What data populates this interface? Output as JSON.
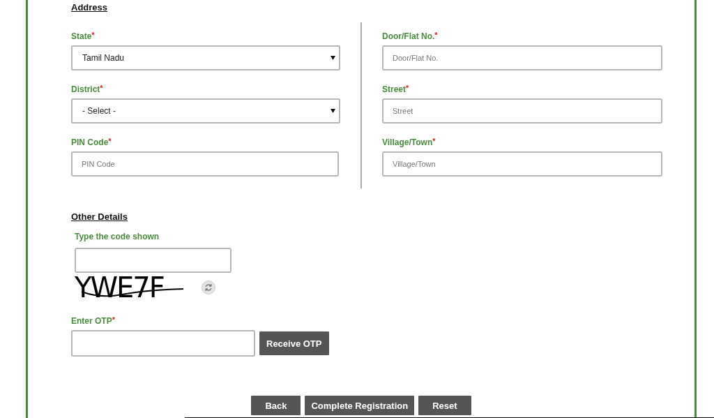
{
  "address": {
    "heading": "Address",
    "left": [
      {
        "kind": "select",
        "label": "State",
        "required_mark": "*",
        "value": "Tamil Nadu"
      },
      {
        "kind": "select",
        "label": "District",
        "required_mark": "*",
        "value": "- Select -"
      },
      {
        "kind": "text",
        "label": "PIN Code",
        "required_mark": "*",
        "placeholder": "PIN Code"
      }
    ],
    "right": [
      {
        "kind": "text",
        "label": "Door/Flat No.",
        "required_mark": "*",
        "placeholder": "Door/Flat No."
      },
      {
        "kind": "text",
        "label": "Street",
        "required_mark": "*",
        "placeholder": "Street"
      },
      {
        "kind": "text",
        "label": "Village/Town",
        "required_mark": "*",
        "placeholder": "Village/Town"
      }
    ]
  },
  "other": {
    "heading": "Other Details",
    "captcha_label": "Type the code shown",
    "captcha_code": "YWE7F",
    "otp_label": "Enter OTP",
    "otp_required_mark": "*",
    "otp_button": "Receive OTP"
  },
  "buttons": [
    "Back",
    "Complete Registration",
    "Reset"
  ]
}
